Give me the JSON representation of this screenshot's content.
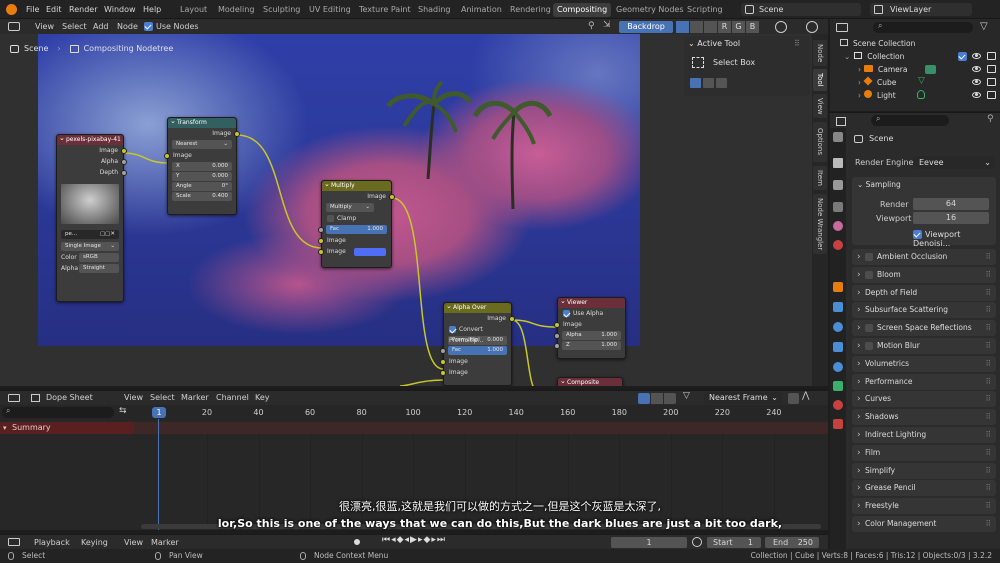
{
  "top_menu": [
    "File",
    "Edit",
    "Render",
    "Window",
    "Help"
  ],
  "workspaces": [
    "Layout",
    "Modeling",
    "Sculpting",
    "UV Editing",
    "Texture Paint",
    "Shading",
    "Animation",
    "Rendering",
    "Compositing",
    "Geometry Nodes",
    "Scripting"
  ],
  "active_workspace": "Compositing",
  "scene_name": "Scene",
  "view_layer": "ViewLayer",
  "node_editor": {
    "menus": [
      "View",
      "Select",
      "Add",
      "Node"
    ],
    "use_nodes_label": "Use Nodes",
    "backdrop_label": "Backdrop",
    "channels": [
      "R",
      "G",
      "B"
    ],
    "breadcrumb_scene": "Scene",
    "breadcrumb_tree": "Compositing Nodetree"
  },
  "nodes": {
    "image_node": {
      "title": "pexels-pixabay-41",
      "outputs": [
        "Image",
        "Alpha",
        "Depth"
      ],
      "file_label": "pe...",
      "source": "Single Image",
      "color_label": "Color",
      "color_value": "sRGB",
      "alpha_label": "Alpha",
      "alpha_value": "Straight"
    },
    "transform": {
      "title": "Transform",
      "output": "Image",
      "filter": "Nearest",
      "input": "Image",
      "fields": [
        {
          "label": "X",
          "value": "0.000"
        },
        {
          "label": "Y",
          "value": "0.000"
        },
        {
          "label": "Angle",
          "value": "0°"
        },
        {
          "label": "Scale",
          "value": "0.400"
        }
      ]
    },
    "multiply": {
      "title": "Multiply",
      "output": "Image",
      "blend": "Multiply",
      "clamp_label": "Clamp",
      "fac_label": "Fac",
      "fac_value": "1.000",
      "input1": "Image",
      "input2": "Image"
    },
    "alpha_over": {
      "title": "Alpha Over",
      "output": "Image",
      "convert_label": "Convert Premultip...",
      "premul_label": "Premultipl",
      "premul_value": "0.000",
      "fac_label": "Fac",
      "fac_value": "1.000",
      "input1": "Image",
      "input2": "Image"
    },
    "viewer": {
      "title": "Viewer",
      "use_alpha_label": "Use Alpha",
      "input": "Image",
      "alpha_label": "Alpha",
      "alpha_value": "1.000",
      "z_label": "Z",
      "z_value": "1.000"
    },
    "composite": {
      "title": "Composite"
    }
  },
  "sidebar_tabs": [
    "Node",
    "Tool",
    "View",
    "Options",
    "Item",
    "Node Wrangler"
  ],
  "active_tool": {
    "title": "Active Tool",
    "tool": "Select Box"
  },
  "outliner": {
    "root": "Scene Collection",
    "collection": "Collection",
    "items": [
      "Camera",
      "Cube",
      "Light"
    ]
  },
  "properties": {
    "context": "Scene",
    "render_engine_label": "Render Engine",
    "render_engine": "Eevee",
    "sampling_label": "Sampling",
    "render_label": "Render",
    "render_value": "64",
    "viewport_label": "Viewport",
    "viewport_value": "16",
    "denoise_label": "Viewport Denoisi...",
    "sections": [
      "Ambient Occlusion",
      "Bloom",
      "Depth of Field",
      "Subsurface Scattering",
      "Screen Space Reflections",
      "Motion Blur",
      "Volumetrics",
      "Performance",
      "Curves",
      "Shadows",
      "Indirect Lighting",
      "Film",
      "Simplify",
      "Grease Pencil",
      "Freestyle",
      "Color Management"
    ],
    "sections_with_checkbox": [
      "Ambient Occlusion",
      "Bloom",
      "Screen Space Reflections",
      "Motion Blur"
    ]
  },
  "dope_sheet": {
    "mode": "Dope Sheet",
    "menus": [
      "View",
      "Select",
      "Marker",
      "Channel",
      "Key"
    ],
    "interpolation": "Nearest Frame",
    "current_frame_marker": "1",
    "ticks": [
      "20",
      "40",
      "60",
      "80",
      "100",
      "120",
      "140",
      "160",
      "180",
      "200",
      "220",
      "240"
    ],
    "summary_label": "Summary"
  },
  "timeline": {
    "menus": [
      "Playback",
      "Keying",
      "View",
      "Marker"
    ],
    "current_frame": "1",
    "start_label": "Start",
    "start_value": "1",
    "end_label": "End",
    "end_value": "250"
  },
  "status_bar": {
    "select": "Select",
    "pan": "Pan View",
    "context_menu": "Node Context Menu",
    "stats": "Collection | Cube | Verts:8 | Faces:6 | Tris:12 | Objects:0/3 | 3.2.2"
  },
  "subtitles": {
    "chinese": "很漂亮,很蓝,这就是我们可以做的方式之一,但是这个灰蓝是太深了,",
    "english": "lor,So this is one of the ways that we can do this,But the dark blues are just a bit too dark,"
  },
  "colors": {
    "accent_blue": "#4772b3",
    "node_header_image": "#6b2f3a",
    "node_header_transform": "#325f5f",
    "node_header_multiply": "#6b6b1f",
    "node_header_viewer": "#6b2f3a",
    "socket_yellow": "#c7c729",
    "socket_gray": "#a1a1a1"
  }
}
